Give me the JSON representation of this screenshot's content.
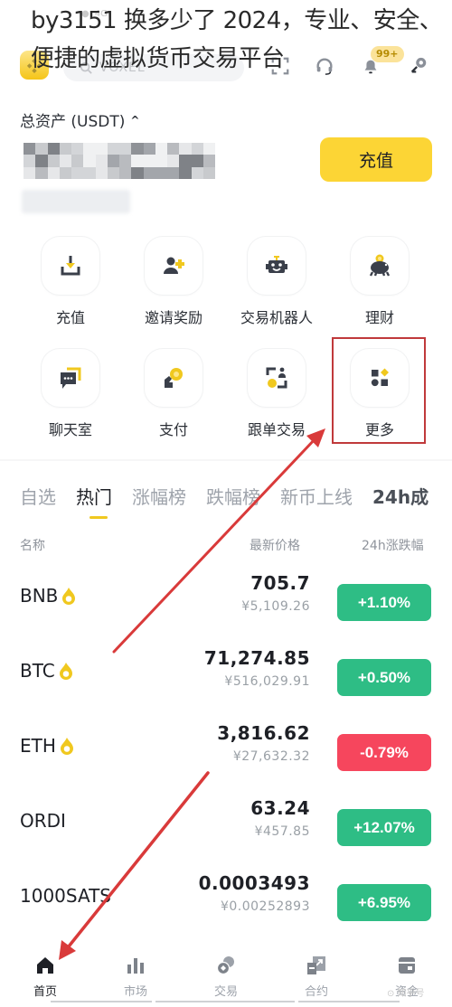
{
  "caption": {
    "line1": "by3151 换多少了 2024，专业、安全、",
    "line2": "便捷的虚拟货币交易平台"
  },
  "header": {
    "search_placeholder": "VOXEL",
    "icons": [
      "scan-icon",
      "headset-icon",
      "bell-icon",
      "profile-switch-icon"
    ],
    "notification_badge": "99+"
  },
  "assets": {
    "label": "总资产 (USDT)",
    "toggle_glyph": "^",
    "value_hidden": true,
    "deposit_button": "充值"
  },
  "quick_actions": [
    {
      "label": "充值",
      "icon": "deposit-icon"
    },
    {
      "label": "邀请奖励",
      "icon": "invite-reward-icon"
    },
    {
      "label": "交易机器人",
      "icon": "trading-bot-icon"
    },
    {
      "label": "理财",
      "icon": "earn-piggy-icon"
    },
    {
      "label": "聊天室",
      "icon": "chat-room-icon"
    },
    {
      "label": "支付",
      "icon": "pay-icon"
    },
    {
      "label": "跟单交易",
      "icon": "copy-trading-icon"
    },
    {
      "label": "更多",
      "icon": "more-grid-icon",
      "highlighted": true
    }
  ],
  "market_tabs": [
    {
      "label": "自选",
      "active": false
    },
    {
      "label": "热门",
      "active": true
    },
    {
      "label": "涨幅榜",
      "active": false
    },
    {
      "label": "跌幅榜",
      "active": false
    },
    {
      "label": "新币上线",
      "active": false
    },
    {
      "label": "24h成",
      "active": false
    }
  ],
  "list_header": {
    "name": "名称",
    "last_price": "最新价格",
    "change": "24h涨跌幅"
  },
  "tickers": [
    {
      "symbol": "BNB",
      "hot": true,
      "price": "705.7",
      "fiat": "¥5,109.26",
      "change": "+1.10%",
      "direction": "up"
    },
    {
      "symbol": "BTC",
      "hot": true,
      "price": "71,274.85",
      "fiat": "¥516,029.91",
      "change": "+0.50%",
      "direction": "up"
    },
    {
      "symbol": "ETH",
      "hot": true,
      "price": "3,816.62",
      "fiat": "¥27,632.32",
      "change": "-0.79%",
      "direction": "down"
    },
    {
      "symbol": "ORDI",
      "hot": false,
      "price": "63.24",
      "fiat": "¥457.85",
      "change": "+12.07%",
      "direction": "up"
    },
    {
      "symbol": "1000SATS",
      "hot": false,
      "price": "0.0003493",
      "fiat": "¥0.00252893",
      "change": "+6.95%",
      "direction": "up"
    }
  ],
  "bottom_nav": [
    {
      "label": "首页",
      "icon": "home-icon",
      "active": true
    },
    {
      "label": "市场",
      "icon": "market-bars-icon",
      "active": false
    },
    {
      "label": "交易",
      "icon": "trade-coins-icon",
      "active": false
    },
    {
      "label": "合约",
      "icon": "futures-icon",
      "active": false
    },
    {
      "label": "资金",
      "icon": "wallet-icon",
      "active": false
    }
  ],
  "watermark": "⊙ 知乎号",
  "colors": {
    "brand_yellow": "#fcd535",
    "up_green": "#2ebd85",
    "down_red": "#f6465d",
    "annotation_red": "#d93a3a",
    "icon_dark": "#3a3f4a",
    "icon_accent": "#f0c81f"
  }
}
